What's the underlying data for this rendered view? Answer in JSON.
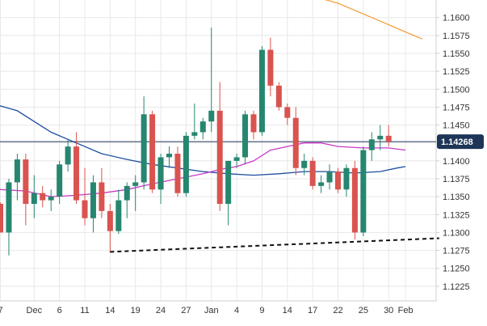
{
  "chart_data": {
    "type": "candlestick",
    "y_ticks": [
      "1.1600",
      "1.1575",
      "1.1550",
      "1.1525",
      "1.1500",
      "1.1475",
      "1.1450",
      "1.1425",
      "1.1400",
      "1.1375",
      "1.1350",
      "1.1325",
      "1.1300",
      "1.1275",
      "1.1250",
      "1.1225"
    ],
    "ylim": [
      1.12,
      1.162
    ],
    "x_ticks": [
      {
        "label": "7",
        "i": 0
      },
      {
        "label": "Dec",
        "i": 4
      },
      {
        "label": "6",
        "i": 7
      },
      {
        "label": "11",
        "i": 10
      },
      {
        "label": "14",
        "i": 13
      },
      {
        "label": "19",
        "i": 16
      },
      {
        "label": "24",
        "i": 19
      },
      {
        "label": "27",
        "i": 22
      },
      {
        "label": "Jan",
        "i": 25
      },
      {
        "label": "4",
        "i": 28
      },
      {
        "label": "9",
        "i": 31
      },
      {
        "label": "14",
        "i": 34
      },
      {
        "label": "17",
        "i": 37
      },
      {
        "label": "22",
        "i": 40
      },
      {
        "label": "25",
        "i": 43
      },
      {
        "label": "30",
        "i": 46
      },
      {
        "label": "Feb",
        "i": 48
      }
    ],
    "n_slots": 51,
    "colors": {
      "up": "#26866f",
      "down": "#d9534f",
      "sma_long": "#f4a13d",
      "sma_mid": "#1f4e9e",
      "sma_short": "#c93ac9",
      "price_line": "#1d3557",
      "tag_bg": "#1d3557",
      "grid": "#e8e8e8"
    },
    "candles": [
      [
        1.134,
        1.1342,
        1.13,
        1.13
      ],
      [
        1.13,
        1.1375,
        1.1268,
        1.137
      ],
      [
        1.137,
        1.141,
        1.1345,
        1.1402
      ],
      [
        1.1402,
        1.141,
        1.131,
        1.134
      ],
      [
        1.134,
        1.138,
        1.132,
        1.1355
      ],
      [
        1.1355,
        1.1365,
        1.1335,
        1.1345
      ],
      [
        1.1345,
        1.136,
        1.133,
        1.135
      ],
      [
        1.135,
        1.14,
        1.134,
        1.1395
      ],
      [
        1.1395,
        1.143,
        1.1385,
        1.142
      ],
      [
        1.142,
        1.144,
        1.134,
        1.1345
      ],
      [
        1.1345,
        1.139,
        1.131,
        1.132
      ],
      [
        1.132,
        1.138,
        1.13,
        1.137
      ],
      [
        1.137,
        1.139,
        1.132,
        1.133
      ],
      [
        1.133,
        1.134,
        1.1272,
        1.1302
      ],
      [
        1.1302,
        1.136,
        1.1298,
        1.1345
      ],
      [
        1.1345,
        1.137,
        1.132,
        1.1365
      ],
      [
        1.1365,
        1.138,
        1.133,
        1.137
      ],
      [
        1.137,
        1.149,
        1.136,
        1.1465
      ],
      [
        1.1465,
        1.147,
        1.1355,
        1.136
      ],
      [
        1.136,
        1.141,
        1.134,
        1.1405
      ],
      [
        1.1405,
        1.142,
        1.139,
        1.141
      ],
      [
        1.141,
        1.142,
        1.135,
        1.1355
      ],
      [
        1.1355,
        1.144,
        1.135,
        1.1435
      ],
      [
        1.1435,
        1.148,
        1.143,
        1.144
      ],
      [
        1.144,
        1.146,
        1.143,
        1.1455
      ],
      [
        1.1455,
        1.1586,
        1.144,
        1.147
      ],
      [
        1.147,
        1.151,
        1.133,
        1.134
      ],
      [
        1.134,
        1.14,
        1.131,
        1.14
      ],
      [
        1.14,
        1.141,
        1.139,
        1.1405
      ],
      [
        1.1405,
        1.147,
        1.1395,
        1.1465
      ],
      [
        1.1465,
        1.147,
        1.143,
        1.144
      ],
      [
        1.144,
        1.156,
        1.1435,
        1.1555
      ],
      [
        1.1555,
        1.1572,
        1.149,
        1.1505
      ],
      [
        1.1505,
        1.151,
        1.147,
        1.1475
      ],
      [
        1.1475,
        1.148,
        1.145,
        1.146
      ],
      [
        1.146,
        1.1475,
        1.138,
        1.139
      ],
      [
        1.139,
        1.141,
        1.138,
        1.14
      ],
      [
        1.14,
        1.1405,
        1.136,
        1.1365
      ],
      [
        1.1365,
        1.138,
        1.1355,
        1.137
      ],
      [
        1.137,
        1.1395,
        1.136,
        1.1385
      ],
      [
        1.1385,
        1.139,
        1.1355,
        1.136
      ],
      [
        1.136,
        1.1395,
        1.135,
        1.139
      ],
      [
        1.139,
        1.14,
        1.129,
        1.13
      ],
      [
        1.13,
        1.142,
        1.1295,
        1.1415
      ],
      [
        1.1415,
        1.144,
        1.14,
        1.143
      ],
      [
        1.143,
        1.145,
        1.1415,
        1.1435
      ],
      [
        1.1435,
        1.145,
        1.142,
        1.1427
      ]
    ],
    "sma_long": [
      [
        34,
        1.164
      ],
      [
        40,
        1.162
      ],
      [
        44,
        1.16
      ],
      [
        47,
        1.1585
      ],
      [
        49,
        1.1575
      ],
      [
        50,
        1.157
      ]
    ],
    "sma_mid": [
      [
        -4,
        1.149
      ],
      [
        2,
        1.147
      ],
      [
        6,
        1.144
      ],
      [
        9,
        1.1425
      ],
      [
        12,
        1.141
      ],
      [
        15,
        1.1402
      ],
      [
        18,
        1.1395
      ],
      [
        21,
        1.139
      ],
      [
        24,
        1.1385
      ],
      [
        27,
        1.1382
      ],
      [
        30,
        1.138
      ],
      [
        33,
        1.1382
      ],
      [
        36,
        1.1385
      ],
      [
        39,
        1.1385
      ],
      [
        42,
        1.1383
      ],
      [
        45,
        1.1385
      ],
      [
        47,
        1.139
      ],
      [
        48,
        1.1392
      ]
    ],
    "sma_short": [
      [
        -4,
        1.137
      ],
      [
        0,
        1.136
      ],
      [
        3,
        1.1358
      ],
      [
        6,
        1.135
      ],
      [
        9,
        1.1352
      ],
      [
        12,
        1.1355
      ],
      [
        15,
        1.136
      ],
      [
        18,
        1.1368
      ],
      [
        21,
        1.1375
      ],
      [
        24,
        1.1382
      ],
      [
        26,
        1.1388
      ],
      [
        28,
        1.1392
      ],
      [
        30,
        1.14
      ],
      [
        32,
        1.1415
      ],
      [
        34,
        1.142
      ],
      [
        36,
        1.1425
      ],
      [
        38,
        1.1425
      ],
      [
        40,
        1.142
      ],
      [
        43,
        1.1418
      ],
      [
        46,
        1.1418
      ],
      [
        48,
        1.1415
      ]
    ],
    "support_line": [
      [
        13,
        1.1273
      ],
      [
        52,
        1.1292
      ]
    ],
    "current_price": 1.14268,
    "current_price_label": "1.14268"
  }
}
